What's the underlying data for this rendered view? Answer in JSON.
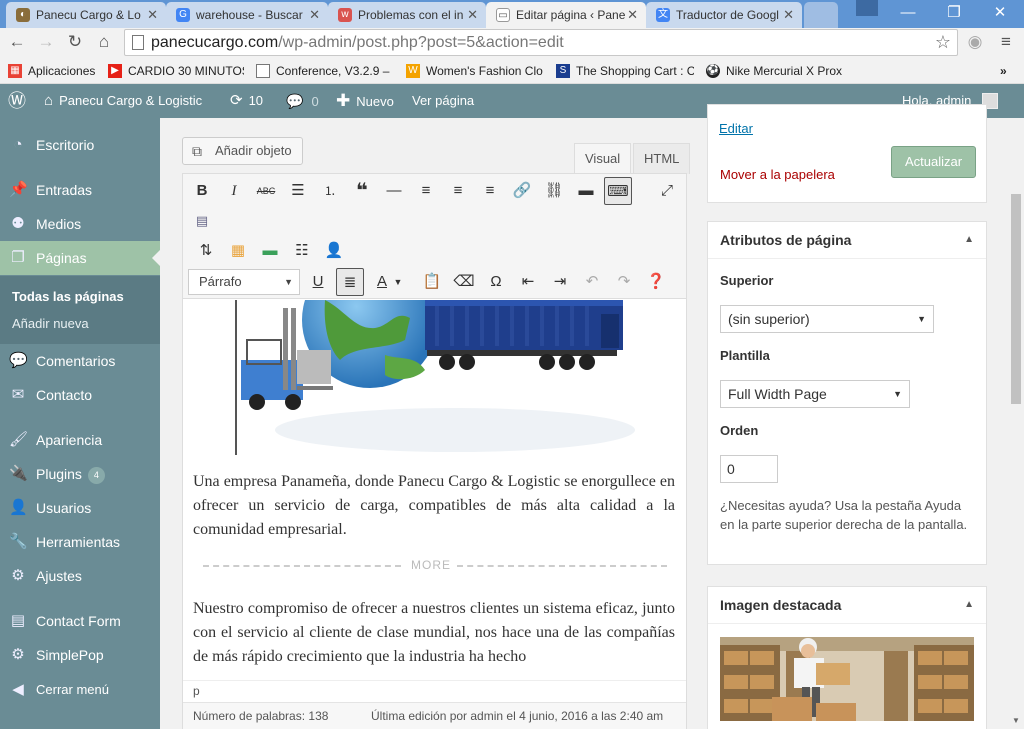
{
  "browser": {
    "tabs": [
      {
        "title": "Panecu Cargo & Lo",
        "icon_color": "#8a6d3b"
      },
      {
        "title": "warehouse - Buscar",
        "icon_color": "#4285f4"
      },
      {
        "title": "Problemas con el in",
        "icon_color": "#d9534f"
      },
      {
        "title": "Editar página ‹ Pane",
        "icon_color": "#6a8c95"
      },
      {
        "title": "Traductor de Googl",
        "icon_color": "#4285f4"
      }
    ],
    "url_host": "panecucargo.com",
    "url_path": "/wp-admin/post.php?post=5&action=edit",
    "bookmarks": [
      {
        "label": "Aplicaciones",
        "color": "#e94235"
      },
      {
        "label": "CARDIO 30 MINUTOS",
        "color": "#e62117"
      },
      {
        "label": "Conference, V3.2.9 –",
        "color": "#777777"
      },
      {
        "label": "Women's Fashion Clo",
        "color": "#f4a300"
      },
      {
        "label": "The Shopping Cart : C",
        "color": "#1a3d8f"
      },
      {
        "label": "Nike Mercurial X Prox",
        "color": "#222222"
      }
    ]
  },
  "adminbar": {
    "site_name": "Panecu Cargo & Logistic",
    "updates_count": "10",
    "comments_count": "0",
    "new_label": "Nuevo",
    "view_page": "Ver página",
    "greeting": "Hola, admin"
  },
  "sidebar": {
    "items": [
      {
        "label": "Escritorio",
        "icon": "dashboard-icon"
      },
      {
        "label": "Entradas",
        "icon": "pin-icon"
      },
      {
        "label": "Medios",
        "icon": "media-icon"
      },
      {
        "label": "Páginas",
        "icon": "pages-icon"
      },
      {
        "label": "Comentarios",
        "icon": "comment-icon"
      },
      {
        "label": "Contacto",
        "icon": "mail-icon"
      },
      {
        "label": "Apariencia",
        "icon": "brush-icon"
      },
      {
        "label": "Plugins",
        "icon": "plug-icon",
        "badge": "4"
      },
      {
        "label": "Usuarios",
        "icon": "user-icon"
      },
      {
        "label": "Herramientas",
        "icon": "wrench-icon"
      },
      {
        "label": "Ajustes",
        "icon": "settings-icon"
      },
      {
        "label": "Contact Form",
        "icon": "form-icon"
      },
      {
        "label": "SimplePop",
        "icon": "gear-icon"
      },
      {
        "label": "Cerrar menú",
        "icon": "collapse-icon"
      }
    ],
    "submenu": [
      "Todas las páginas",
      "Añadir nueva"
    ]
  },
  "editor": {
    "add_media": "Añadir objeto",
    "tab_visual": "Visual",
    "tab_html": "HTML",
    "format": "Párrafo",
    "paragraph1": "Una empresa Panameña, donde Panecu Cargo & Logistic se enorgullece en ofrecer un servicio de carga,  compatibles de más alta calidad a la comunidad empresarial.",
    "more_label": "MORE",
    "paragraph2": "Nuestro compromiso de ofrecer a nuestros clientes un sistema eficaz, junto con el servicio al cliente de clase mundial, nos hace una de las compañías de más rápido crecimiento que la industria ha hecho",
    "path": "p",
    "word_count": "Número de palabras: 138",
    "last_edit": "Última edición por admin el 4 junio, 2016 a las 2:40 am"
  },
  "publish": {
    "edit_link": "Editar",
    "trash": "Mover a la papelera",
    "update": "Actualizar"
  },
  "attributes": {
    "title": "Atributos de página",
    "parent_label": "Superior",
    "parent_value": "(sin superior)",
    "template_label": "Plantilla",
    "template_value": "Full Width Page",
    "order_label": "Orden",
    "order_value": "0",
    "help": "¿Necesitas ayuda? Usa la pestaña Ayuda en la parte superior derecha de la pantalla."
  },
  "featured": {
    "title": "Imagen destacada"
  },
  "colors": {
    "admin": "#6a8c95",
    "current": "#9ec2a7",
    "chrome_blue": "#5f95d4"
  }
}
